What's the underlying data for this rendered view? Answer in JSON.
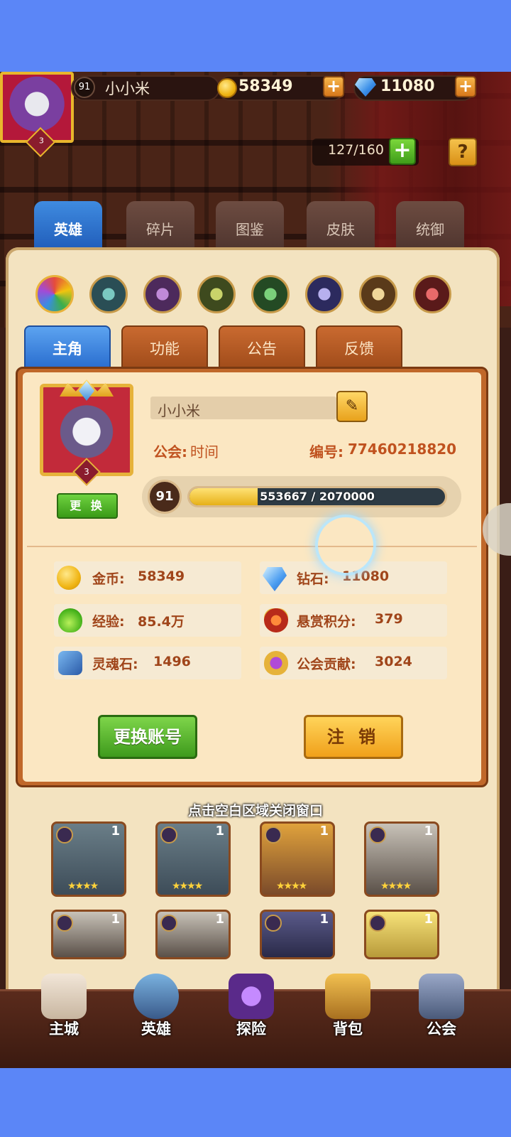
{
  "player": {
    "level": "91",
    "name": "小小米",
    "portrait_rank": "3"
  },
  "currency": {
    "gold": "58349",
    "diamonds": "11080",
    "plus": "+"
  },
  "capacity": "127/160",
  "help": "?",
  "book_tabs": [
    {
      "label": "英雄",
      "active": true
    },
    {
      "label": "碎片",
      "active": false
    },
    {
      "label": "图鉴",
      "active": false
    },
    {
      "label": "皮肤",
      "active": false
    },
    {
      "label": "统御",
      "active": false
    }
  ],
  "element_filters": [
    "all",
    "water",
    "arcane",
    "wind",
    "nature",
    "shadow",
    "light",
    "fire"
  ],
  "modal": {
    "tabs": [
      {
        "label": "主角",
        "active": true
      },
      {
        "label": "功能",
        "active": false
      },
      {
        "label": "公告",
        "active": false
      },
      {
        "label": "反馈",
        "active": false
      }
    ],
    "change_label": "更 换",
    "name_value": "小小米",
    "guild_label": "公会:",
    "guild_value": "时间",
    "id_label": "编号:",
    "id_value": "77460218820",
    "xp_level": "91",
    "xp_current": 553667,
    "xp_max": 2070000,
    "xp_text": "553667 / 2070000",
    "stats": [
      {
        "label": "金币:",
        "value": "58349",
        "icon": "gold-coin-icon"
      },
      {
        "label": "钻石:",
        "value": "11080",
        "icon": "diamond-icon"
      },
      {
        "label": "经验:",
        "value": "85.4万",
        "icon": "exp-potion-icon"
      },
      {
        "label": "悬赏积分:",
        "value": "379",
        "icon": "bounty-badge-icon"
      },
      {
        "label": "灵魂石:",
        "value": "1496",
        "icon": "soul-stone-icon"
      },
      {
        "label": "公会贡献:",
        "value": "3024",
        "icon": "guild-badge-icon"
      }
    ],
    "switch_account": "更换账号",
    "logout": "注 销"
  },
  "close_hint": "点击空白区域关闭窗口",
  "hero_cards": [
    {
      "count": "1",
      "stars": "★★★★"
    },
    {
      "count": "1",
      "stars": "★★★★"
    },
    {
      "count": "1",
      "stars": "★★★★"
    },
    {
      "count": "1",
      "stars": "★★★★"
    },
    {
      "count": "1",
      "stars": ""
    },
    {
      "count": "1",
      "stars": ""
    },
    {
      "count": "1",
      "stars": ""
    },
    {
      "count": "1",
      "stars": ""
    }
  ],
  "bottom_nav": [
    {
      "label": "主城"
    },
    {
      "label": "英雄"
    },
    {
      "label": "探险"
    },
    {
      "label": "背包"
    },
    {
      "label": "公会"
    }
  ]
}
